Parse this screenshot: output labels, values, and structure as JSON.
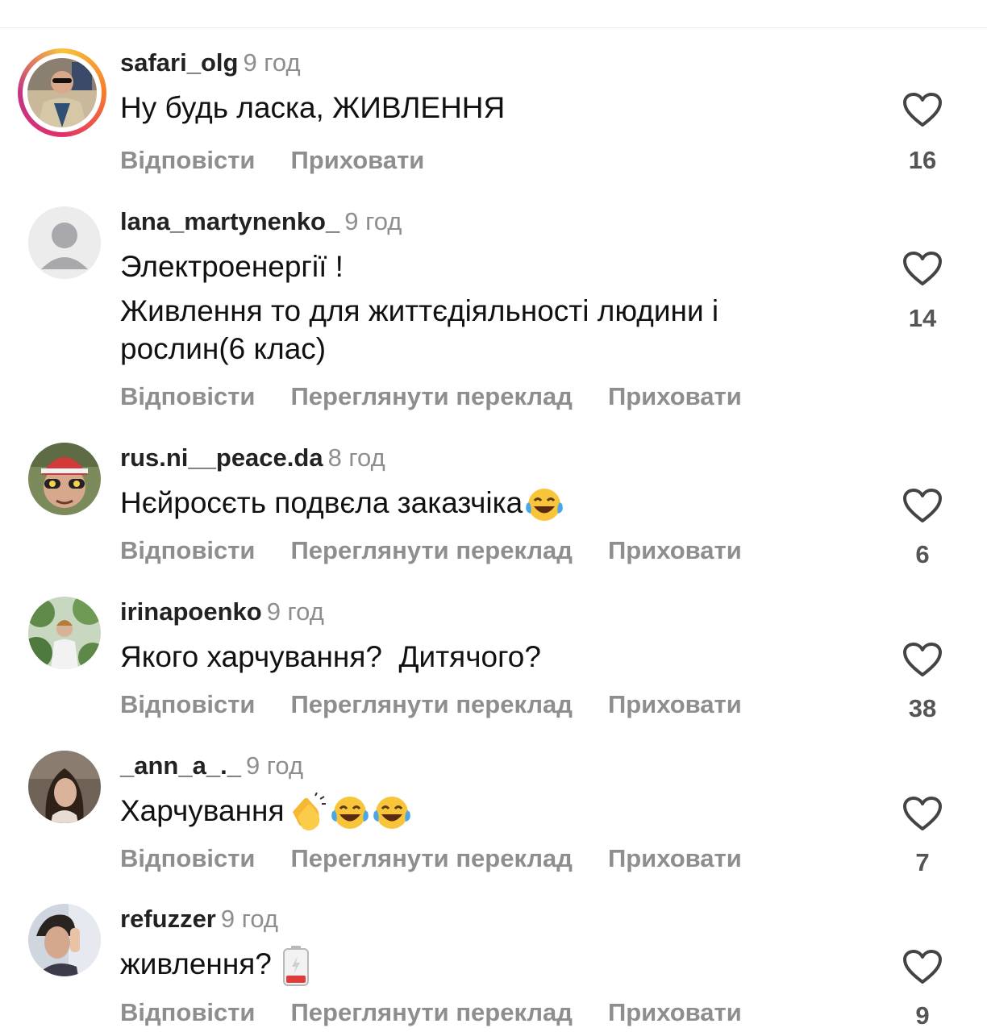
{
  "labels": {
    "reply": "Відповісти",
    "translate": "Переглянути переклад",
    "hide": "Приховати"
  },
  "comments": [
    {
      "username": "safari_olg",
      "time": "9 год",
      "text": "Ну будь ласка, ЖИВЛЕННЯ",
      "likes": "16",
      "avatar": "photo-story-ring"
    },
    {
      "username": "lana_martynenko_",
      "time": "9 год",
      "text1": "Электроенергії !",
      "text2": "Живлення то для життєдіяльності людини і рослин(6 клас)",
      "likes": "14",
      "avatar": "default-user-icon"
    },
    {
      "username": "rus.ni__peace.da",
      "time": "8 год",
      "text": "Нєйросєть подвєла заказчіка",
      "emoji": "tears-of-joy-emoji",
      "likes": "6",
      "avatar": "photo"
    },
    {
      "username": "irinapoenko",
      "time": "9 год",
      "text": "Якого харчування?  Дитячого?",
      "likes": "38",
      "avatar": "photo"
    },
    {
      "username": "_ann_a_._",
      "time": "9 год",
      "text": "Харчування",
      "emoji": "clapping-hands-emoji tears-of-joy-emoji tears-of-joy-emoji",
      "likes": "7",
      "avatar": "photo"
    },
    {
      "username": "refuzzer",
      "time": "9 год",
      "text": "живлення?",
      "emoji": "low-battery-emoji",
      "likes": "9",
      "avatar": "photo"
    }
  ],
  "colors": {
    "secondary_text": "#8e8e8e",
    "story_ring": [
      "#f9c33a",
      "#e1306c",
      "#c13584"
    ]
  }
}
